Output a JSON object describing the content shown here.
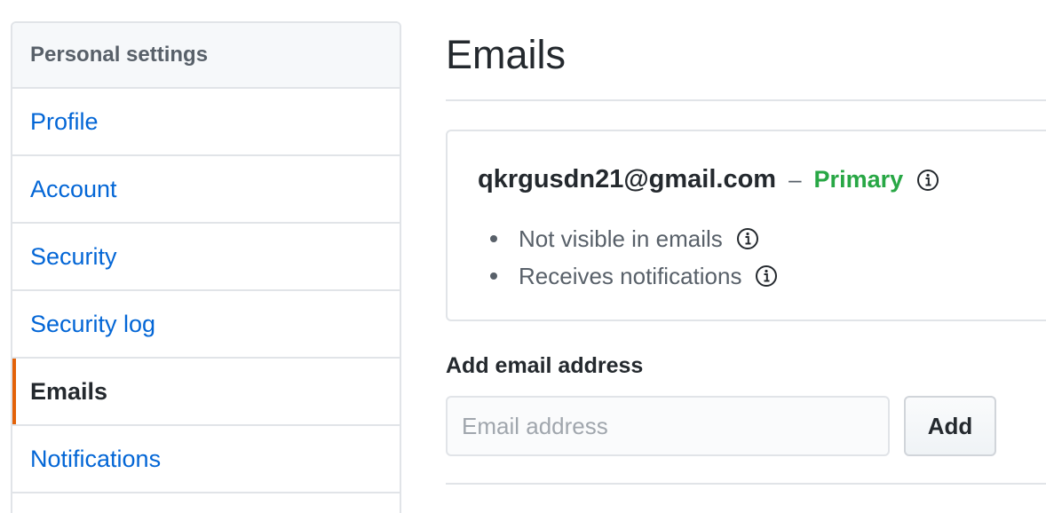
{
  "sidebar": {
    "header": "Personal settings",
    "items": [
      {
        "label": "Profile"
      },
      {
        "label": "Account"
      },
      {
        "label": "Security"
      },
      {
        "label": "Security log"
      },
      {
        "label": "Emails",
        "selected": true
      },
      {
        "label": "Notifications"
      }
    ]
  },
  "main": {
    "title": "Emails",
    "email_entry": {
      "address": "qkrgusdn21@gmail.com",
      "separator": "–",
      "primary_label": "Primary",
      "details": [
        "Not visible in emails",
        "Receives notifications"
      ]
    },
    "add_email": {
      "label": "Add email address",
      "placeholder": "Email address",
      "value": "",
      "button_label": "Add"
    }
  },
  "colors": {
    "link": "#0366d6",
    "primary": "#28a745",
    "selected_indicator": "#e36209",
    "border": "#e1e4e8"
  },
  "icons": {
    "info": "info-icon"
  }
}
